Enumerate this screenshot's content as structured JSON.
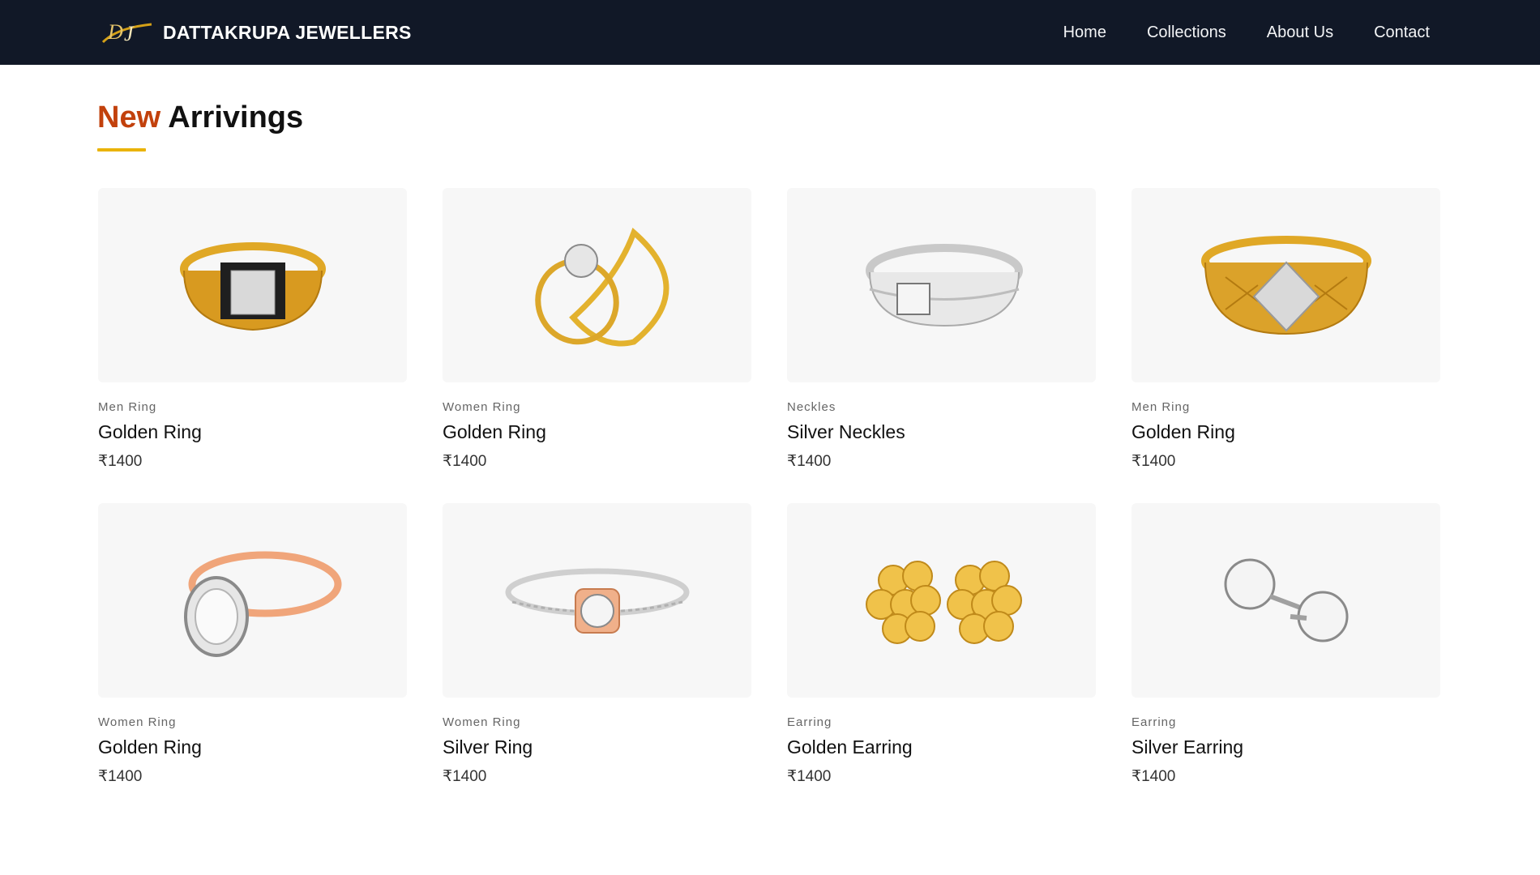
{
  "nav": {
    "brand_name": "DATTAKRUPA JEWELLERS",
    "logo_icon": "dj-monogram-logo",
    "links": [
      "Home",
      "Collections",
      "About Us",
      "Contact"
    ]
  },
  "section": {
    "title_accent": "New",
    "title_rest": "Arrivings"
  },
  "colors": {
    "navbar_bg": "#111827",
    "accent": "#c2410c",
    "underline": "#eab308",
    "card_bg": "#f7f7f7"
  },
  "products": [
    {
      "category": "Men Ring",
      "title": "Golden Ring",
      "price": "₹1400",
      "image": "gold-men-ring-image"
    },
    {
      "category": "Women Ring",
      "title": "Golden Ring",
      "price": "₹1400",
      "image": "gold-teardrop-ring-image"
    },
    {
      "category": "Neckles",
      "title": "Silver Neckles",
      "price": "₹1400",
      "image": "silver-band-ring-image"
    },
    {
      "category": "Men Ring",
      "title": "Golden Ring",
      "price": "₹1400",
      "image": "gold-diamond-ring-image"
    },
    {
      "category": "Women Ring",
      "title": "Golden Ring",
      "price": "₹1400",
      "image": "rose-gold-halo-ring-image"
    },
    {
      "category": "Women Ring",
      "title": "Silver Ring",
      "price": "₹1400",
      "image": "silver-solitaire-ring-image"
    },
    {
      "category": "Earring",
      "title": "Golden Earring",
      "price": "₹1400",
      "image": "gold-flower-earrings-image"
    },
    {
      "category": "Earring",
      "title": "Silver Earring",
      "price": "₹1400",
      "image": "silver-stud-earrings-image"
    }
  ]
}
